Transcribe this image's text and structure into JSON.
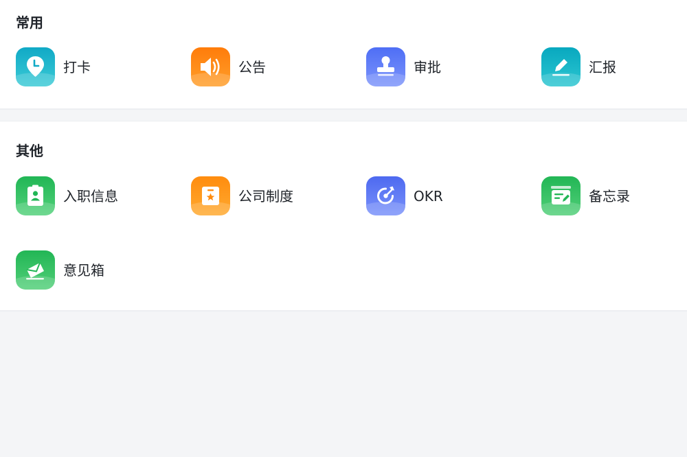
{
  "sections": [
    {
      "title": "常用",
      "items": [
        {
          "label": "打卡",
          "icon": "location-clock-icon",
          "color_top": "#10a9c6",
          "color_bottom": "#3ccbd6"
        },
        {
          "label": "公告",
          "icon": "megaphone-icon",
          "color_top": "#ff7c0a",
          "color_bottom": "#ff9f2b"
        },
        {
          "label": "审批",
          "icon": "stamp-icon",
          "color_top": "#4e6ef5",
          "color_bottom": "#7d95fb"
        },
        {
          "label": "汇报",
          "icon": "pencil-icon",
          "color_top": "#08a8bf",
          "color_bottom": "#2cc6d1"
        }
      ]
    },
    {
      "title": "其他",
      "items": [
        {
          "label": "入职信息",
          "icon": "id-badge-icon",
          "color_top": "#21b655",
          "color_bottom": "#53d17b"
        },
        {
          "label": "公司制度",
          "icon": "star-document-icon",
          "color_top": "#ff8c0e",
          "color_bottom": "#ffaa30"
        },
        {
          "label": "OKR",
          "icon": "target-icon",
          "color_top": "#4d69f0",
          "color_bottom": "#7a92fa"
        },
        {
          "label": "备忘录",
          "icon": "memo-icon",
          "color_top": "#22b655",
          "color_bottom": "#52cf79"
        },
        {
          "label": "意见箱",
          "icon": "envelope-icon",
          "color_top": "#22b655",
          "color_bottom": "#52cf79"
        }
      ]
    }
  ]
}
